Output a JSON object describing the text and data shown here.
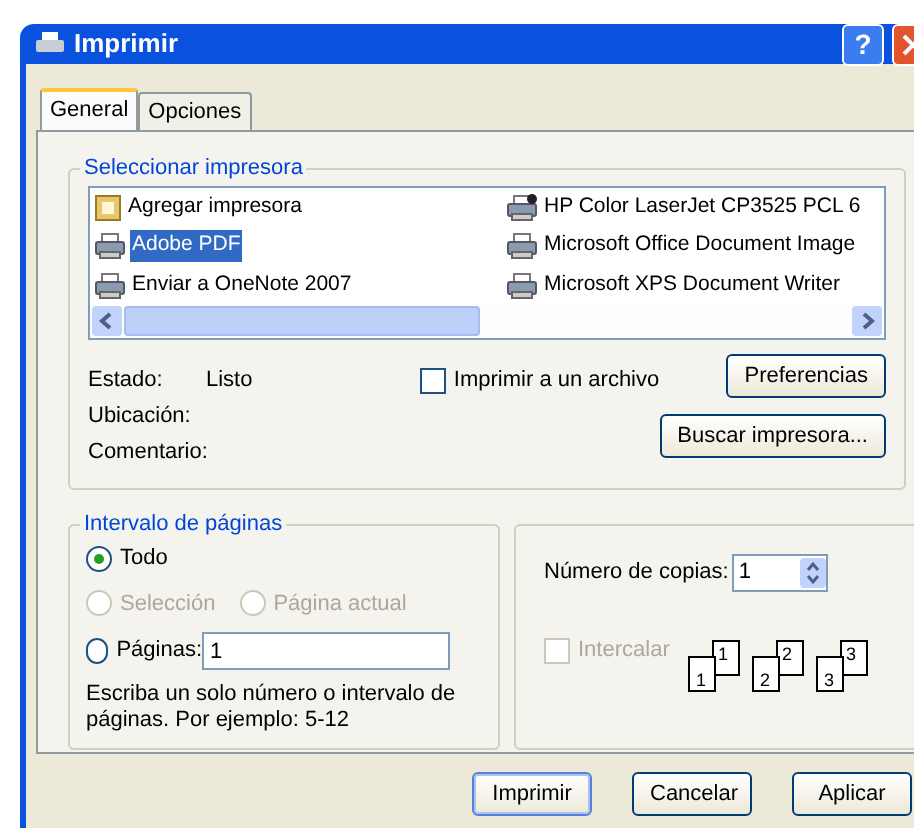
{
  "window": {
    "title": "Imprimir",
    "help": "?"
  },
  "tabs": [
    {
      "label": "General",
      "selected": true
    },
    {
      "label": "Opciones",
      "selected": false
    }
  ],
  "printer_group": {
    "title": "Seleccionar impresora",
    "printers": [
      {
        "name": "Agregar impresora",
        "kind": "add",
        "selected": false
      },
      {
        "name": "HP Color LaserJet CP3525 PCL 6",
        "kind": "default",
        "selected": false
      },
      {
        "name": "Adobe PDF",
        "kind": "printer",
        "selected": true
      },
      {
        "name": "Microsoft Office Document Image",
        "kind": "printer",
        "selected": false
      },
      {
        "name": "Enviar a OneNote 2007",
        "kind": "printer",
        "selected": false
      },
      {
        "name": "Microsoft XPS Document Writer",
        "kind": "printer",
        "selected": false
      }
    ],
    "info": [
      {
        "label": "Estado:",
        "value": "Listo"
      },
      {
        "label": "Ubicación:"
      },
      {
        "label": "Comentario:"
      }
    ],
    "print_to_file": {
      "label": "Imprimir a un archivo",
      "checked": false
    },
    "preferences_button": "Preferencias",
    "find_button": "Buscar impresora..."
  },
  "range_group": {
    "title": "Intervalo de páginas",
    "options": [
      {
        "label": "Todo",
        "selected": true,
        "disabled": false
      },
      {
        "label": "Selección",
        "selected": false,
        "disabled": true
      },
      {
        "label": "Página actual",
        "selected": false,
        "disabled": true
      },
      {
        "label": "Páginas:",
        "selected": false,
        "disabled": false
      }
    ],
    "pages_value": "1",
    "hint": "Escriba un solo número o intervalo de páginas. Por ejemplo: 5-12"
  },
  "copies_group": {
    "label": "Número de copias:",
    "value": "1",
    "collate": {
      "label": "Intercalar",
      "checked": false,
      "disabled": true
    },
    "pages": [
      {
        "back": "1",
        "front": "1"
      },
      {
        "back": "2",
        "front": "2"
      },
      {
        "back": "3",
        "front": "3"
      }
    ]
  },
  "buttons": [
    "Imprimir",
    "Cancelar",
    "Aplicar"
  ]
}
